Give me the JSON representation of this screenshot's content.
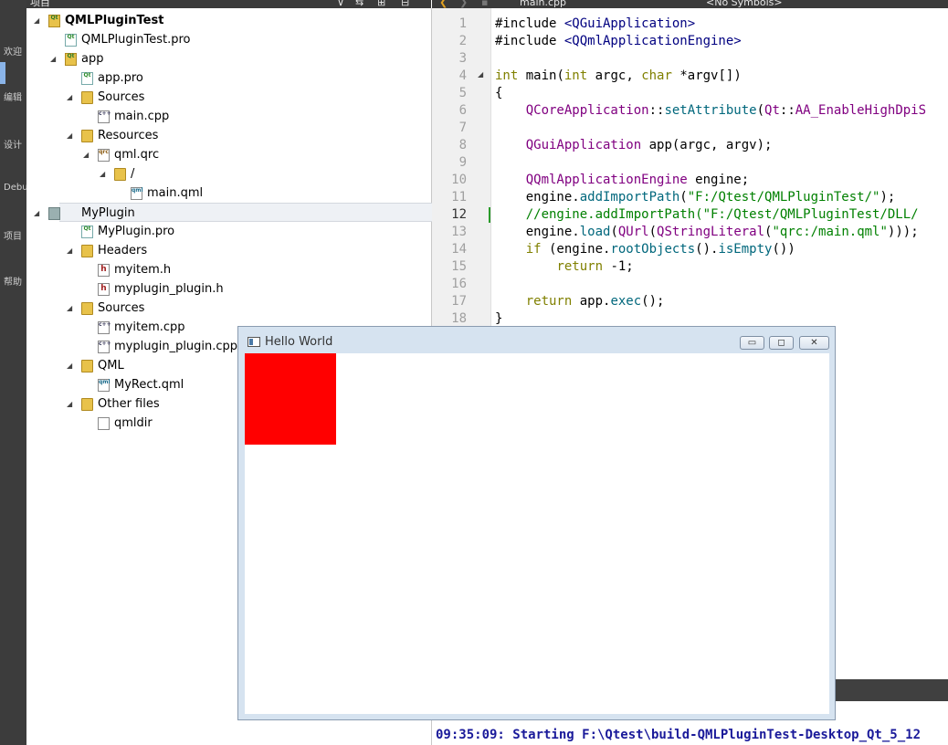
{
  "mode_bar": {
    "items": [
      "欢迎",
      "编辑",
      "设计",
      "Debug",
      "项目",
      "帮助"
    ]
  },
  "project_panel": {
    "header": "项目",
    "tree": [
      {
        "label": "QMLPluginTest",
        "bold": true,
        "icon": "qt-project-folder-icon"
      },
      {
        "label": "QMLPluginTest.pro",
        "icon": "pro-file-icon"
      },
      {
        "label": "app",
        "icon": "qt-project-folder-icon"
      },
      {
        "label": "app.pro",
        "icon": "pro-file-icon"
      },
      {
        "label": "Sources",
        "icon": "sources-folder-icon"
      },
      {
        "label": "main.cpp",
        "icon": "cpp-file-icon"
      },
      {
        "label": "Resources",
        "icon": "resources-folder-icon"
      },
      {
        "label": "qml.qrc",
        "icon": "qrc-file-icon"
      },
      {
        "label": "/",
        "icon": "folder-icon"
      },
      {
        "label": "main.qml",
        "icon": "qml-file-icon"
      },
      {
        "label": "MyPlugin",
        "icon": "library-project-icon"
      },
      {
        "label": "MyPlugin.pro",
        "icon": "pro-file-icon"
      },
      {
        "label": "Headers",
        "icon": "headers-folder-icon"
      },
      {
        "label": "myitem.h",
        "icon": "header-file-icon"
      },
      {
        "label": "myplugin_plugin.h",
        "icon": "header-file-icon"
      },
      {
        "label": "Sources",
        "icon": "sources-folder-icon"
      },
      {
        "label": "myitem.cpp",
        "icon": "cpp-file-icon"
      },
      {
        "label": "myplugin_plugin.cpp",
        "icon": "cpp-file-icon"
      },
      {
        "label": "QML",
        "icon": "qml-folder-icon"
      },
      {
        "label": "MyRect.qml",
        "icon": "qml-file-icon"
      },
      {
        "label": "Other files",
        "icon": "other-files-folder-icon"
      },
      {
        "label": "qmldir",
        "icon": "text-file-icon"
      }
    ]
  },
  "editor": {
    "file_tab": "main.cpp",
    "symbols": "<No Symbols>",
    "current_line": 12,
    "lines": [
      {
        "n": "1",
        "text": "#include <QGuiApplication>"
      },
      {
        "n": "2",
        "text": "#include <QQmlApplicationEngine>"
      },
      {
        "n": "3",
        "text": ""
      },
      {
        "n": "4",
        "text": "int main(int argc, char *argv[])"
      },
      {
        "n": "5",
        "text": "{"
      },
      {
        "n": "6",
        "text": "    QCoreApplication::setAttribute(Qt::AA_EnableHighDpiS"
      },
      {
        "n": "7",
        "text": ""
      },
      {
        "n": "8",
        "text": "    QGuiApplication app(argc, argv);"
      },
      {
        "n": "9",
        "text": ""
      },
      {
        "n": "10",
        "text": "    QQmlApplicationEngine engine;"
      },
      {
        "n": "11",
        "text": "    engine.addImportPath(\"F:/Qtest/QMLPluginTest/\");"
      },
      {
        "n": "12",
        "text": "    //engine.addImportPath(\"F:/Qtest/QMLPluginTest/DLL/"
      },
      {
        "n": "13",
        "text": "    engine.load(QUrl(QStringLiteral(\"qrc:/main.qml\")));"
      },
      {
        "n": "14",
        "text": "    if (engine.rootObjects().isEmpty())"
      },
      {
        "n": "15",
        "text": "        return -1;"
      },
      {
        "n": "16",
        "text": ""
      },
      {
        "n": "17",
        "text": "    return app.exec();"
      },
      {
        "n": "18",
        "text": "}"
      }
    ]
  },
  "output": {
    "text": "09:35:09: Starting F:\\Qtest\\build-QMLPluginTest-Desktop_Qt_5_12"
  },
  "app_window": {
    "title": "Hello World",
    "rect_color": "#ff0000",
    "minimize": "▭",
    "maximize": "◻",
    "close": "✕"
  }
}
